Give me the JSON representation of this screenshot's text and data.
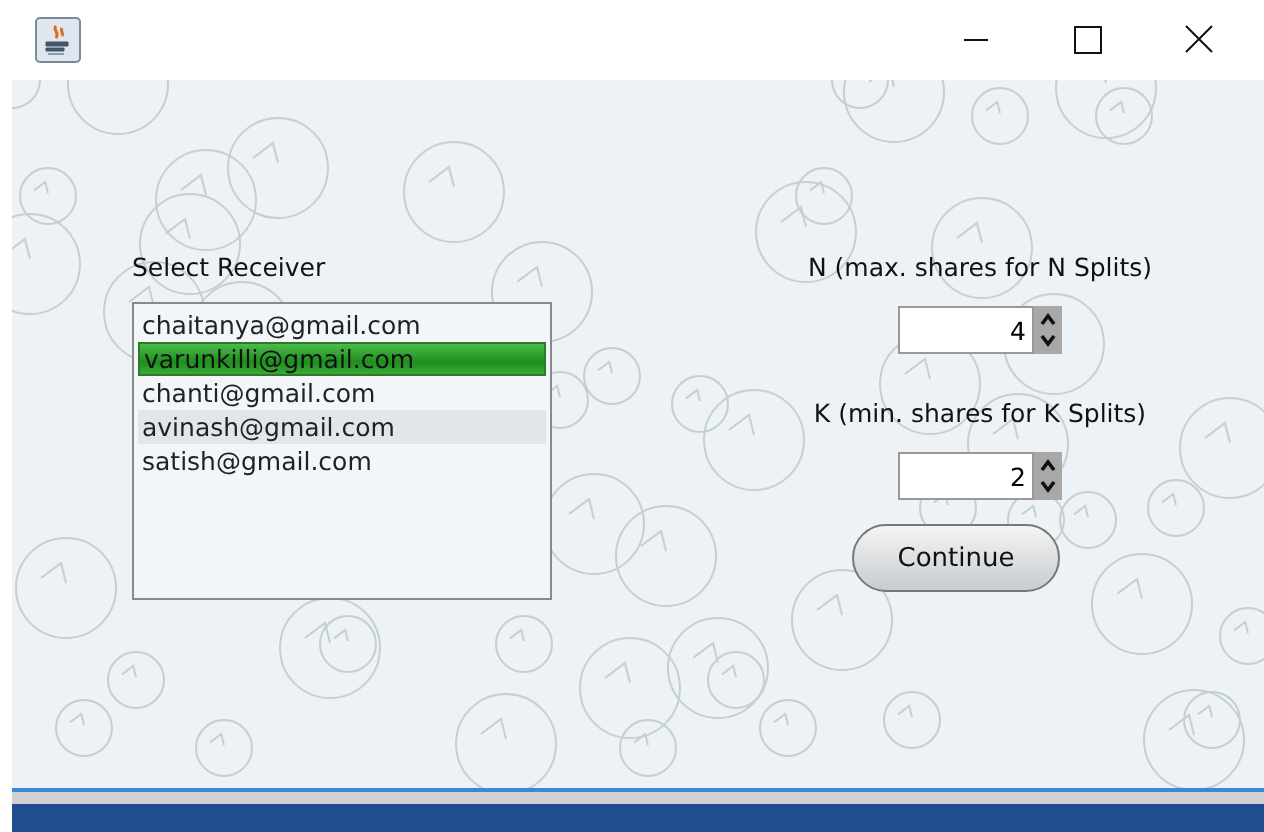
{
  "receiver_list": {
    "label": "Select Receiver",
    "items": [
      {
        "email": "chaitanya@gmail.com",
        "selected": false,
        "hovered": false
      },
      {
        "email": "varunkilli@gmail.com",
        "selected": true,
        "hovered": false
      },
      {
        "email": "chanti@gmail.com",
        "selected": false,
        "hovered": false
      },
      {
        "email": "avinash@gmail.com",
        "selected": false,
        "hovered": true
      },
      {
        "email": "satish@gmail.com",
        "selected": false,
        "hovered": false
      }
    ]
  },
  "spinners": [
    {
      "label": "N (max. shares for N Splits)",
      "value": "4"
    },
    {
      "label": "K (min. shares for K Splits)",
      "value": "2"
    }
  ],
  "buttons": [
    "Continue"
  ]
}
